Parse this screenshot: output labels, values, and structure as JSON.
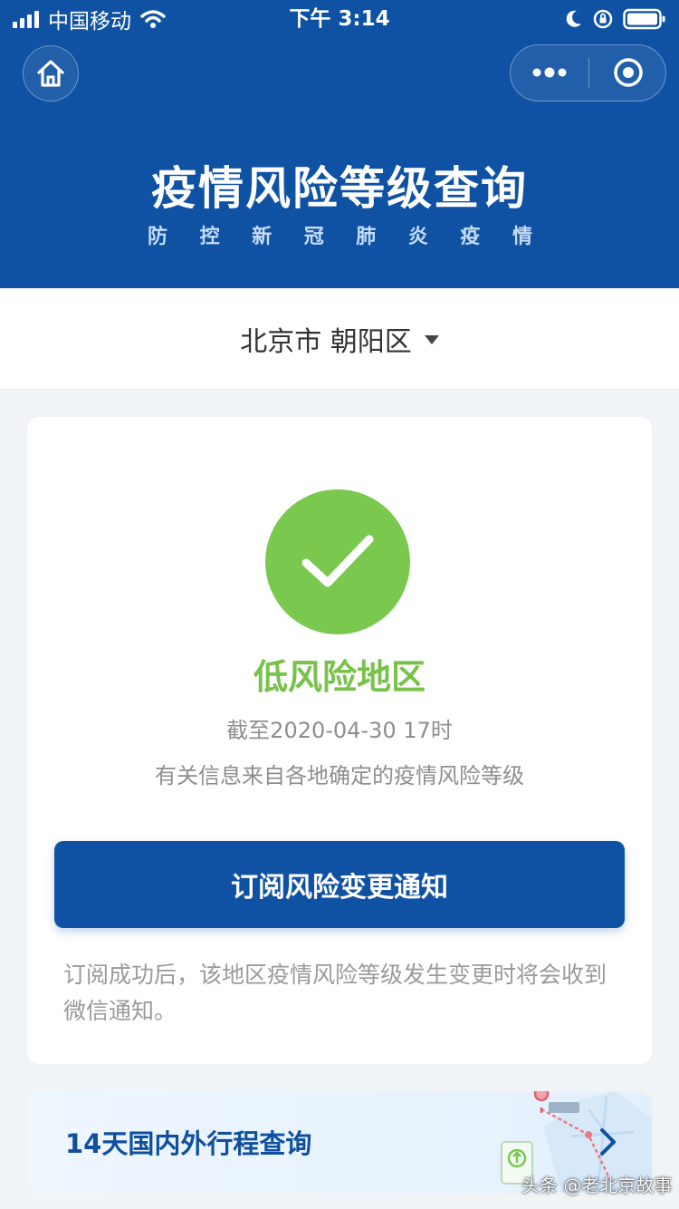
{
  "status_bar": {
    "carrier": "中国移动",
    "time": "下午 3:14"
  },
  "header": {
    "title": "疫情风险等级查询",
    "subtitle_chars": [
      "防",
      "控",
      "新",
      "冠",
      "肺",
      "炎",
      "疫",
      "情"
    ]
  },
  "location": {
    "value": "北京市 朝阳区"
  },
  "risk_card": {
    "status_icon": "checkmark-icon",
    "risk_level": "低风险地区",
    "as_of": "截至2020-04-30 17时",
    "source_note": "有关信息来自各地确定的疫情风险等级",
    "subscribe_button": "订阅风险变更通知",
    "subscribe_note": "订阅成功后，该地区疫情风险等级发生变更时将会收到微信通知。"
  },
  "travel_query": {
    "label": "14天国内外行程查询"
  },
  "watermark": "头条 @老北京故事",
  "colors": {
    "primary": "#0f52a3",
    "success": "#7ac84e",
    "background": "#f1f4f7"
  }
}
